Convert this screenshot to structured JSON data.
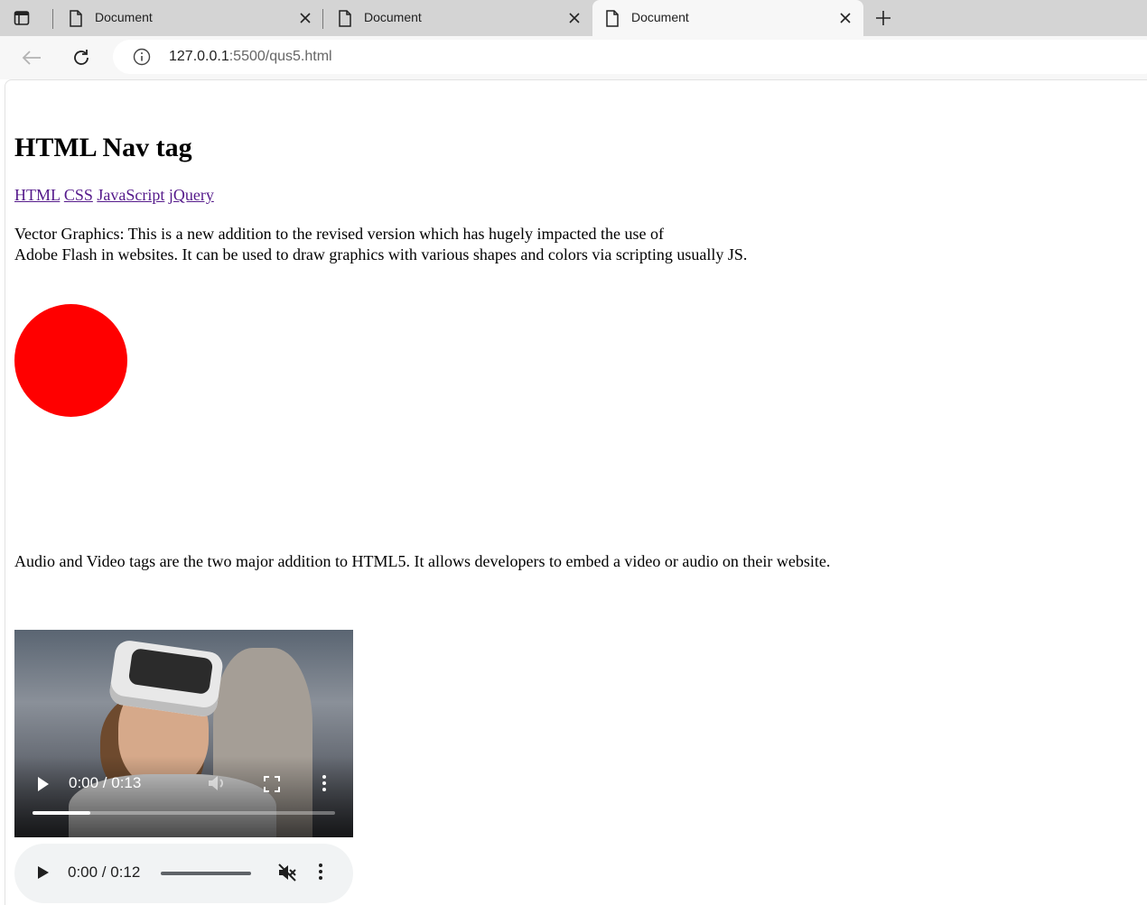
{
  "browser": {
    "tabs": [
      {
        "label": "Document",
        "active": false
      },
      {
        "label": "Document",
        "active": false
      },
      {
        "label": "Document",
        "active": true
      }
    ],
    "url_host": "127.0.0.1",
    "url_rest": ":5500/qus5.html"
  },
  "page": {
    "heading": "HTML Nav tag",
    "nav_links": [
      "HTML",
      "CSS",
      "JavaScript",
      "jQuery"
    ],
    "para1_line1": "Vector Graphics: This is a new addition to the revised version which has hugely impacted the use of",
    "para1_line2": "Adobe Flash in websites. It can be used to draw graphics with various shapes and colors via scripting usually JS.",
    "para2": "Audio and Video tags are the two major addition to HTML5. It allows developers to embed a video or audio on their website.",
    "circle_color": "#ff0000"
  },
  "video": {
    "time": "0:00 / 0:13",
    "progress": 0.19
  },
  "audio": {
    "time": "0:00 / 0:12",
    "muted": true
  },
  "colors": {
    "link": "#551a8b",
    "tabbar": "#d4d4d4",
    "toolbar": "#f7f7f7"
  }
}
